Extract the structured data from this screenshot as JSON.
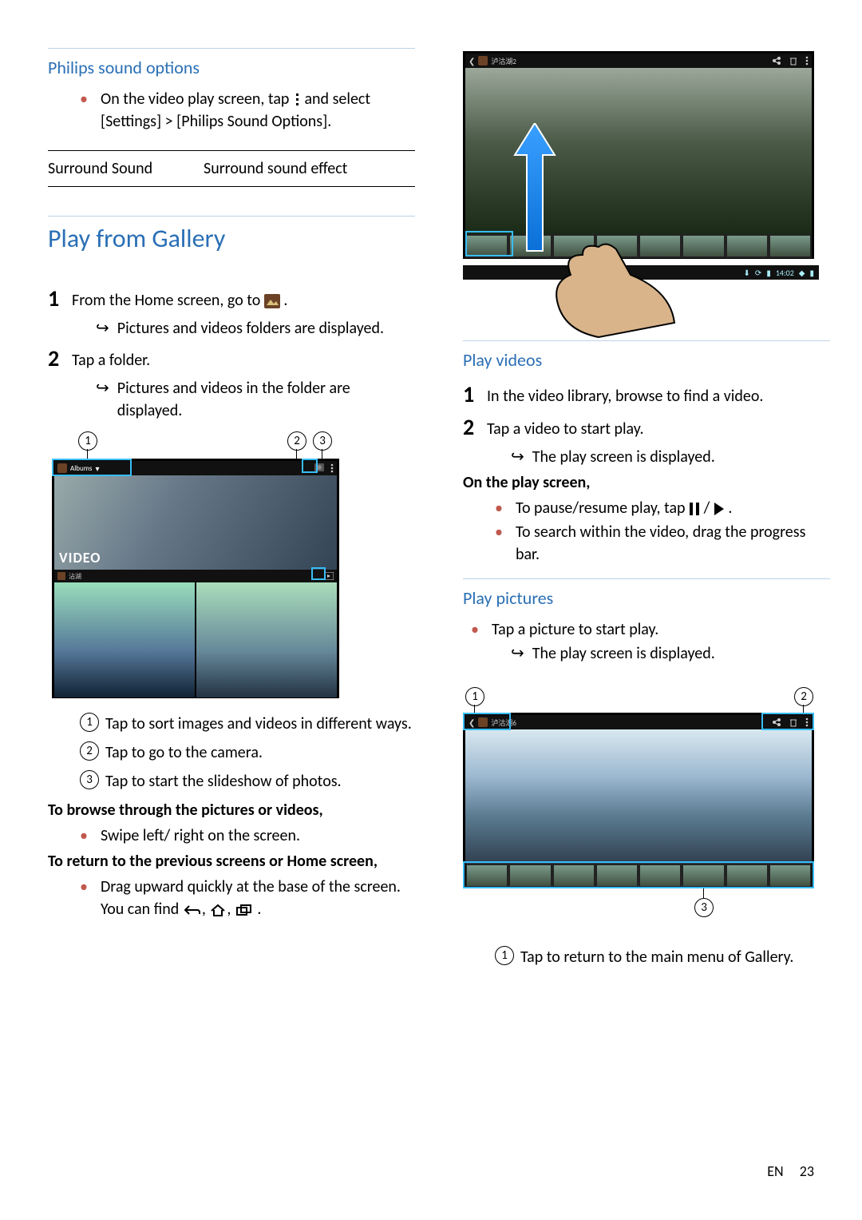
{
  "left": {
    "sound_title": "Philips sound options",
    "sound_step_pre": "On the video play screen, tap ",
    "sound_step_post": " and select [Settings] > [Philips Sound Options].",
    "table": {
      "c1": "Surround Sound",
      "c2": "Surround sound effect"
    },
    "gallery_title": "Play from Gallery",
    "step1_pre": "From the Home screen, go to ",
    "step1_post": " .",
    "step1_result": "Pictures and videos folders are displayed.",
    "step2": "Tap a folder.",
    "step2_result": "Pictures and videos in the folder are displayed.",
    "callouts": {
      "1": "Tap to sort images and videos in different ways.",
      "2": "Tap to go to the camera.",
      "3": "Tap to start the slideshow of photos."
    },
    "browse_heading": "To browse through the pictures or videos,",
    "browse_b1": "Swipe left/ right on the screen.",
    "return_heading": "To return to the previous screens or Home screen,",
    "return_b1_pre": "Drag upward quickly at the base of the screen. You can find ",
    "return_b1_post": "."
  },
  "right": {
    "play_videos_title": "Play videos",
    "v_step1": "In the video library, browse to find a video.",
    "v_step2": "Tap a video to start play.",
    "v_step2_result": "The play screen is displayed.",
    "on_play_heading": "On the play screen,",
    "on_play_b1_pre": "To pause/resume play, tap ",
    "on_play_b1_post": ".",
    "on_play_b2": "To search within the video, drag the progress bar.",
    "play_pictures_title": "Play pictures",
    "pic_b1": "Tap a picture to start play.",
    "pic_b1_result": "The play screen is displayed.",
    "pic_callout1": "Tap to return to the main menu of Gallery.",
    "fig2_time": "14:02",
    "fig1_albums": "Albums"
  },
  "footer": {
    "lang": "EN",
    "page": "23"
  }
}
